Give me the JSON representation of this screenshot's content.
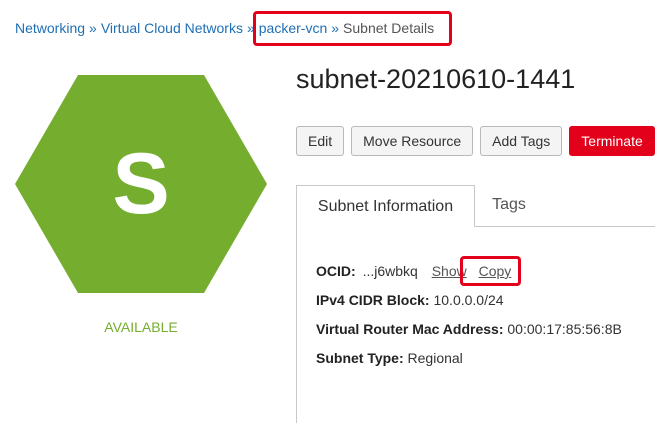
{
  "breadcrumb": {
    "networking": "Networking",
    "sep1": "»",
    "vcns": "Virtual Cloud Networks",
    "sep2": "»",
    "vcn": "packer-vcn",
    "sep3": "»",
    "current": "Subnet Details"
  },
  "resource": {
    "icon_letter": "S",
    "status": "AVAILABLE",
    "title": "subnet-20210610-1441"
  },
  "actions": {
    "edit": "Edit",
    "move": "Move Resource",
    "add_tags": "Add Tags",
    "terminate": "Terminate"
  },
  "tabs": {
    "info": "Subnet Information",
    "tags": "Tags"
  },
  "details": {
    "ocid_label": "OCID:",
    "ocid_value": "...j6wbkq",
    "show": "Show",
    "copy": "Copy",
    "cidr_label": "IPv4 CIDR Block:",
    "cidr_value": "10.0.0.0/24",
    "mac_label": "Virtual Router Mac Address:",
    "mac_value": "00:00:17:85:56:8B",
    "type_label": "Subnet Type:",
    "type_value": "Regional"
  },
  "colors": {
    "hexagon": "#75ad2e",
    "status": "#75ad2e",
    "link": "#1f6fb5",
    "danger": "#e3001b",
    "highlight": "#e3001b"
  }
}
